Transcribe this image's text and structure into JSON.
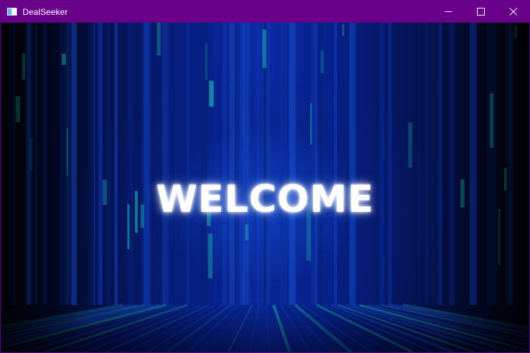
{
  "window": {
    "title": "DealSeeker",
    "icon": "app-window-icon",
    "controls": {
      "minimize_icon": "minimize-icon",
      "maximize_icon": "maximize-icon",
      "close_icon": "close-icon"
    },
    "titlebar_color": "#6a008a"
  },
  "main": {
    "heading": "WELCOME",
    "background": "blue-digital-light-streaks",
    "accent_color": "#0a2aa6",
    "streak_color": "#1fb3b0"
  }
}
